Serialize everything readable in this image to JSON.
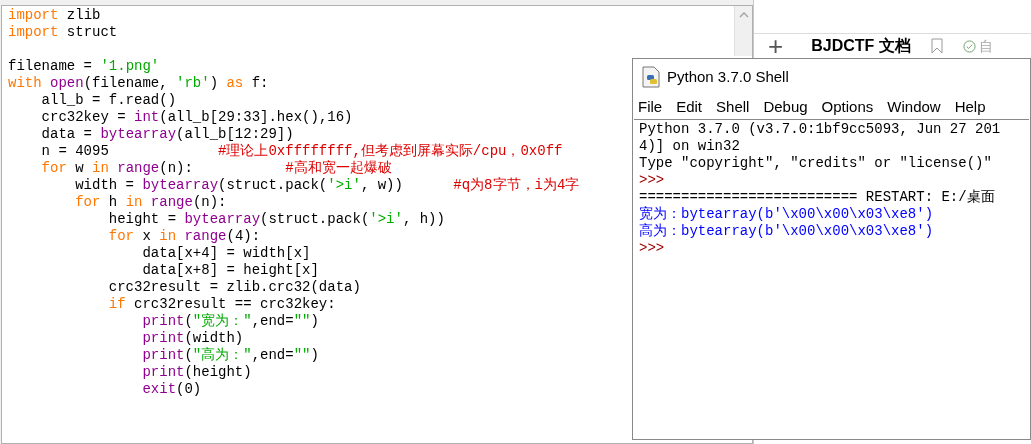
{
  "editor": {
    "lines": [
      {
        "kind": "code",
        "segments": [
          {
            "kind": "keyword",
            "text": "import"
          },
          {
            "kind": "plain",
            "text": " zlib"
          }
        ]
      },
      {
        "kind": "code",
        "segments": [
          {
            "kind": "keyword",
            "text": "import"
          },
          {
            "kind": "plain",
            "text": " struct"
          }
        ]
      },
      {
        "kind": "blank"
      },
      {
        "kind": "code",
        "segments": [
          {
            "kind": "plain",
            "text": "filename = "
          },
          {
            "kind": "string",
            "text": "'1.png'"
          }
        ]
      },
      {
        "kind": "code",
        "segments": [
          {
            "kind": "keyword",
            "text": "with "
          },
          {
            "kind": "builtin",
            "text": "open"
          },
          {
            "kind": "plain",
            "text": "(filename, "
          },
          {
            "kind": "string",
            "text": "'rb'"
          },
          {
            "kind": "plain",
            "text": ") "
          },
          {
            "kind": "keyword",
            "text": "as"
          },
          {
            "kind": "plain",
            "text": " f:"
          }
        ]
      },
      {
        "kind": "code",
        "segments": [
          {
            "kind": "plain",
            "text": "    all_b = f.read()"
          }
        ]
      },
      {
        "kind": "code",
        "segments": [
          {
            "kind": "plain",
            "text": "    crc32key = "
          },
          {
            "kind": "builtin",
            "text": "int"
          },
          {
            "kind": "plain",
            "text": "(all_b[29:33].hex(),16)"
          }
        ]
      },
      {
        "kind": "code",
        "segments": [
          {
            "kind": "plain",
            "text": "    data = "
          },
          {
            "kind": "builtin",
            "text": "bytearray"
          },
          {
            "kind": "plain",
            "text": "(all_b[12:29])"
          }
        ]
      },
      {
        "kind": "code",
        "segments": [
          {
            "kind": "plain",
            "text": "    n = 4095             "
          },
          {
            "kind": "comment",
            "text": "#理论上0xffffffff,但考虑到屏幕实际/cpu，0x0ff"
          }
        ]
      },
      {
        "kind": "code",
        "segments": [
          {
            "kind": "keyword",
            "text": "    for"
          },
          {
            "kind": "plain",
            "text": " w "
          },
          {
            "kind": "keyword",
            "text": "in "
          },
          {
            "kind": "builtin",
            "text": "range"
          },
          {
            "kind": "plain",
            "text": "(n):           "
          },
          {
            "kind": "comment",
            "text": "#高和宽一起爆破"
          }
        ]
      },
      {
        "kind": "code",
        "segments": [
          {
            "kind": "plain",
            "text": "        width = "
          },
          {
            "kind": "builtin",
            "text": "bytearray"
          },
          {
            "kind": "plain",
            "text": "(struct.pack("
          },
          {
            "kind": "string",
            "text": "'>i'"
          },
          {
            "kind": "plain",
            "text": ", w))      "
          },
          {
            "kind": "comment",
            "text": "#q为8字节，i为4字"
          }
        ]
      },
      {
        "kind": "code",
        "segments": [
          {
            "kind": "keyword",
            "text": "        for"
          },
          {
            "kind": "plain",
            "text": " h "
          },
          {
            "kind": "keyword",
            "text": "in "
          },
          {
            "kind": "builtin",
            "text": "range"
          },
          {
            "kind": "plain",
            "text": "(n):"
          }
        ]
      },
      {
        "kind": "code",
        "segments": [
          {
            "kind": "plain",
            "text": "            height = "
          },
          {
            "kind": "builtin",
            "text": "bytearray"
          },
          {
            "kind": "plain",
            "text": "(struct.pack("
          },
          {
            "kind": "string",
            "text": "'>i'"
          },
          {
            "kind": "plain",
            "text": ", h))"
          }
        ]
      },
      {
        "kind": "code",
        "segments": [
          {
            "kind": "keyword",
            "text": "            for"
          },
          {
            "kind": "plain",
            "text": " x "
          },
          {
            "kind": "keyword",
            "text": "in "
          },
          {
            "kind": "builtin",
            "text": "range"
          },
          {
            "kind": "plain",
            "text": "(4):"
          }
        ]
      },
      {
        "kind": "code",
        "segments": [
          {
            "kind": "plain",
            "text": "                data[x+4] = width[x]"
          }
        ]
      },
      {
        "kind": "code",
        "segments": [
          {
            "kind": "plain",
            "text": "                data[x+8] = height[x]"
          }
        ]
      },
      {
        "kind": "code",
        "segments": [
          {
            "kind": "plain",
            "text": "            crc32result = zlib.crc32(data)"
          }
        ]
      },
      {
        "kind": "code",
        "segments": [
          {
            "kind": "keyword",
            "text": "            if"
          },
          {
            "kind": "plain",
            "text": " crc32result == crc32key:"
          }
        ]
      },
      {
        "kind": "code",
        "segments": [
          {
            "kind": "builtin",
            "text": "                print"
          },
          {
            "kind": "plain",
            "text": "("
          },
          {
            "kind": "string",
            "text": "\"宽为：\""
          },
          {
            "kind": "plain",
            "text": ",end="
          },
          {
            "kind": "string",
            "text": "\"\""
          },
          {
            "kind": "plain",
            "text": ")"
          }
        ]
      },
      {
        "kind": "code",
        "segments": [
          {
            "kind": "builtin",
            "text": "                print"
          },
          {
            "kind": "plain",
            "text": "(width)"
          }
        ]
      },
      {
        "kind": "code",
        "segments": [
          {
            "kind": "builtin",
            "text": "                print"
          },
          {
            "kind": "plain",
            "text": "("
          },
          {
            "kind": "string",
            "text": "\"高为：\""
          },
          {
            "kind": "plain",
            "text": ",end="
          },
          {
            "kind": "string",
            "text": "\"\""
          },
          {
            "kind": "plain",
            "text": ")"
          }
        ]
      },
      {
        "kind": "code",
        "segments": [
          {
            "kind": "builtin",
            "text": "                print"
          },
          {
            "kind": "plain",
            "text": "(height)"
          }
        ]
      },
      {
        "kind": "code",
        "segments": [
          {
            "kind": "builtin",
            "text": "                exit"
          },
          {
            "kind": "plain",
            "text": "(0)"
          }
        ]
      }
    ]
  },
  "doc_app": {
    "add_label": "+",
    "title": "BJDCTF 文档",
    "status": "自"
  },
  "shell": {
    "title": "Python 3.7.0 Shell",
    "menu": [
      "File",
      "Edit",
      "Shell",
      "Debug",
      "Options",
      "Window",
      "Help"
    ],
    "lines": [
      {
        "kind": "output",
        "text": "Python 3.7.0 (v3.7.0:1bf9cc5093, Jun 27 201"
      },
      {
        "kind": "output",
        "text": "4)] on win32"
      },
      {
        "kind": "output",
        "text": "Type \"copyright\", \"credits\" or \"license()\""
      },
      {
        "kind": "prompt",
        "text": ">>>"
      },
      {
        "kind": "output",
        "text": "========================== RESTART: E:/桌面"
      },
      {
        "kind": "stdout",
        "text": "宽为：bytearray(b'\\x00\\x00\\x03\\xe8')"
      },
      {
        "kind": "stdout",
        "text": "高为：bytearray(b'\\x00\\x00\\x03\\xe8')"
      },
      {
        "kind": "prompt",
        "text": ">>>"
      }
    ]
  }
}
